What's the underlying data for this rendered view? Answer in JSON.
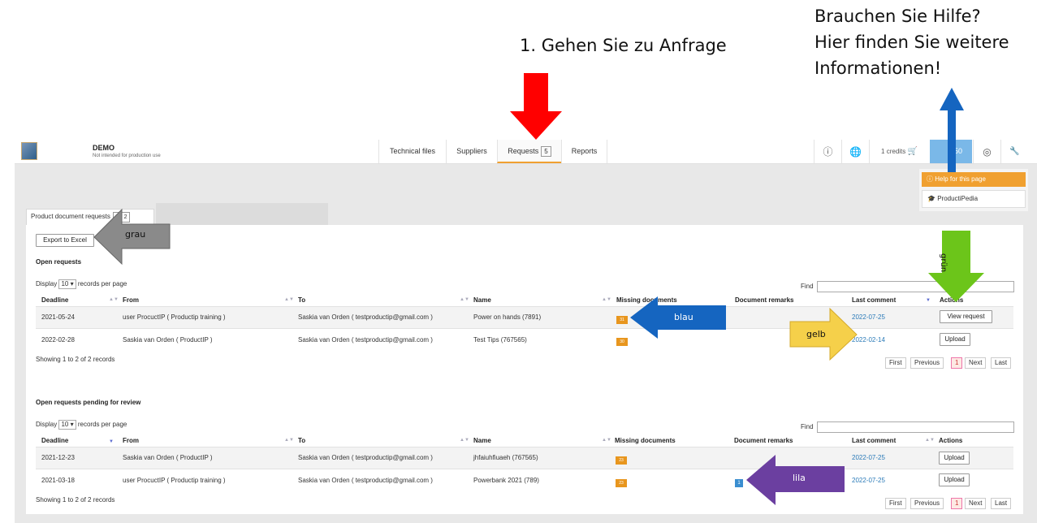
{
  "annotations": {
    "step1": "1. Gehen Sie zu Anfrage",
    "help_line1": "Brauchen Sie Hilfe?",
    "help_line2": "Hier finden Sie weitere",
    "help_line3": "Informationen!",
    "grau": "grau",
    "blau": "blau",
    "gelb": "gelb",
    "gruen": "grün",
    "lila": "lila",
    "colors": {
      "red": "#ff0000",
      "blue": "#1565c0",
      "grey": "#8a8a8a",
      "green": "#6cc51a",
      "yellow": "#f5d04a",
      "purple": "#6b3fa0"
    }
  },
  "app": {
    "name": "DEMO",
    "subtitle": "Not intended for production use",
    "logo_icon": "product-box-icon"
  },
  "nav": {
    "tabs": [
      {
        "label": "Technical files"
      },
      {
        "label": "Suppliers"
      },
      {
        "label": "Requests",
        "badge": "5",
        "active": true
      },
      {
        "label": "Reports"
      }
    ],
    "info_icon": "ⓘ",
    "globe_icon": "🌐",
    "credits": "1 credits",
    "cart_icon": "🛒",
    "help_count": "50",
    "user_icon": "◎",
    "wrench_icon": "🔧"
  },
  "help_menu": {
    "help_item": "Help for this page",
    "pedia_item": "ProductiPedia"
  },
  "page": {
    "tab_label": "Product document requests",
    "tab_badge": "2 / 2",
    "export_button": "Export to Excel",
    "display_label": "Display",
    "records_per_page": "records per page",
    "page_size": "10",
    "find_label": "Find"
  },
  "open_requests": {
    "title": "Open requests",
    "columns": [
      "Deadline",
      "From",
      "To",
      "Name",
      "Missing documents",
      "Document remarks",
      "Last comment",
      "Actions"
    ],
    "rows": [
      {
        "deadline": "2021-05-24",
        "from": "user ProcuctIP ( Productip training )",
        "to": "Saskia van Orden ( testproductip@gmail.com )",
        "name": "Power on hands (7891)",
        "missing": "31",
        "remarks": "",
        "last_comment": "2022-07-25",
        "action": "View request"
      },
      {
        "deadline": "2022-02-28",
        "from": "Saskia van Orden ( ProductIP )",
        "to": "Saskia van Orden ( testproductip@gmail.com )",
        "name": "Test Tips (767565)",
        "missing": "30",
        "remarks": "",
        "last_comment": "2022-02-14",
        "action": "Upload"
      }
    ],
    "showing": "Showing 1 to 2 of 2 records",
    "pager": {
      "first": "First",
      "previous": "Previous",
      "current": "1",
      "next": "Next",
      "last": "Last"
    }
  },
  "pending_requests": {
    "title": "Open requests pending for review",
    "columns": [
      "Deadline",
      "From",
      "To",
      "Name",
      "Missing documents",
      "Document remarks",
      "Last comment",
      "Actions"
    ],
    "rows": [
      {
        "deadline": "2021-12-23",
        "from": "Saskia van Orden ( ProductIP )",
        "to": "Saskia van Orden ( testproductip@gmail.com )",
        "name": "jhfaiuhfiuaeh (767565)",
        "missing": "23",
        "remarks": "",
        "last_comment": "2022-07-25",
        "action": "Upload"
      },
      {
        "deadline": "2021-03-18",
        "from": "user ProcuctIP ( Productip training )",
        "to": "Saskia van Orden ( testproductip@gmail.com )",
        "name": "Powerbank 2021 (789)",
        "missing": "23",
        "remarks": "1",
        "last_comment": "2022-07-25",
        "action": "Upload"
      }
    ],
    "showing": "Showing 1 to 2 of 2 records",
    "pager": {
      "first": "First",
      "previous": "Previous",
      "current": "1",
      "next": "Next",
      "last": "Last"
    }
  }
}
